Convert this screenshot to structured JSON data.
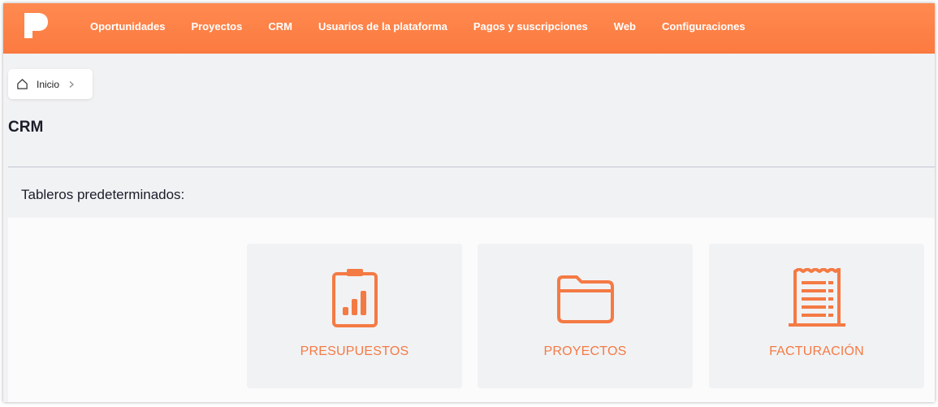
{
  "nav": {
    "items": [
      "Oportunidades",
      "Proyectos",
      "CRM",
      "Usuarios de la plataforma",
      "Pagos y suscripciones",
      "Web",
      "Configuraciones"
    ]
  },
  "breadcrumb": {
    "home_icon": "home-icon",
    "label": "Inicio",
    "separator_icon": "chevron-right-icon"
  },
  "page": {
    "title": "CRM"
  },
  "section": {
    "title": "Tableros predeterminados:"
  },
  "cards": [
    {
      "label": "PRESUPUESTOS",
      "icon": "clipboard-chart-icon"
    },
    {
      "label": "PROYECTOS",
      "icon": "folder-icon"
    },
    {
      "label": "FACTURACIÓN",
      "icon": "receipt-icon"
    }
  ],
  "colors": {
    "brand": "#fb7a40",
    "accent_text": "#f47a44",
    "background": "#f1f2f4"
  }
}
